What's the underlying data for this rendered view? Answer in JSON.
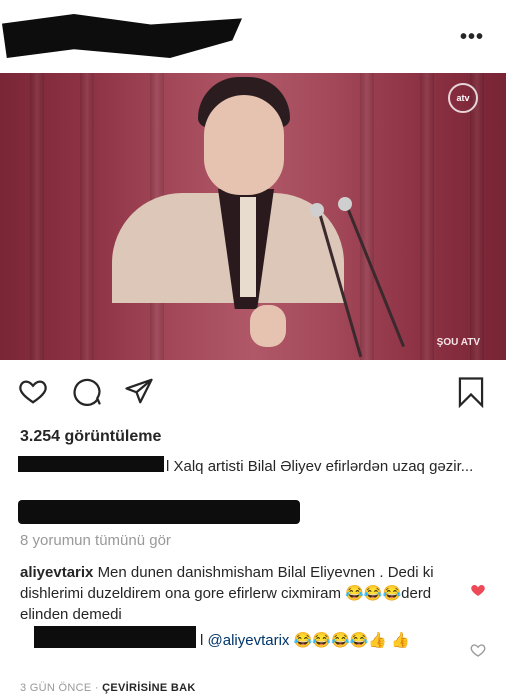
{
  "post": {
    "more_icon": "•••",
    "video_logo_text": "atv",
    "video_watermark": "ŞOU ATV",
    "views": "3.254 görüntüleme",
    "caption": "l Xalq artisti Bilal Əliyev efirlərdən uzaq gəzir...",
    "view_all_comments": "8 yorumun tümünü gör"
  },
  "comments": [
    {
      "username": "aliyevtarix",
      "text": "Men dunen danishmisham Bilal Eliyevnen . Dedi ki dishlerimi duzeldirem ona gore efirlerw cixmiram 😂😂😂derd elinden demedi",
      "liked_color": "#ed4956"
    }
  ],
  "reply": {
    "prefix": "l ",
    "mention": "@aliyevtarix",
    "text": " 😂😂😂😂👍 👍"
  },
  "footer": {
    "time": "3 GÜN ÖNCE",
    "separator": " · ",
    "translate": "ÇEVİRİSİNE BAK"
  },
  "icons": [
    "more-icon",
    "heart-icon",
    "comment-icon",
    "share-icon",
    "bookmark-icon",
    "liked-heart-icon",
    "like-reply-icon"
  ]
}
